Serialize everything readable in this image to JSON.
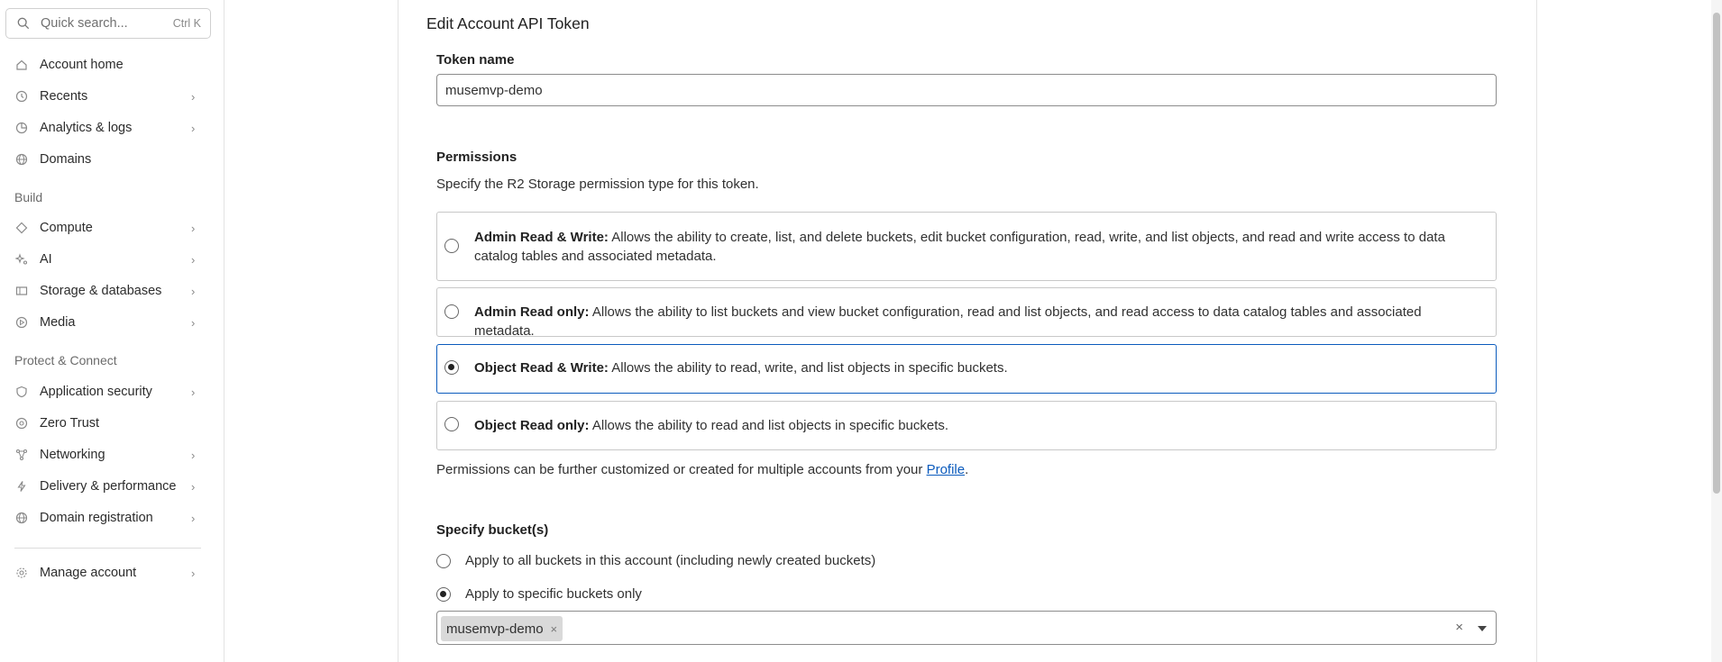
{
  "search": {
    "placeholder": "Quick search...",
    "shortcut": "Ctrl K"
  },
  "sidebar": {
    "top_items": [
      {
        "label": "Account home",
        "icon": "home-icon"
      },
      {
        "label": "Recents",
        "icon": "clock-icon"
      },
      {
        "label": "Analytics & logs",
        "icon": "chart-icon"
      },
      {
        "label": "Domains",
        "icon": "globe-icon"
      }
    ],
    "build_header": "Build",
    "build_items": [
      {
        "label": "Compute",
        "icon": "diamond-icon"
      },
      {
        "label": "AI",
        "icon": "sparkle-icon"
      },
      {
        "label": "Storage & databases",
        "icon": "storage-icon"
      },
      {
        "label": "Media",
        "icon": "media-icon"
      }
    ],
    "protect_header": "Protect & Connect",
    "protect_items": [
      {
        "label": "Application security",
        "icon": "shield-icon"
      },
      {
        "label": "Zero Trust",
        "icon": "zero-trust-icon"
      },
      {
        "label": "Networking",
        "icon": "network-icon"
      },
      {
        "label": "Delivery & performance",
        "icon": "bolt-icon"
      },
      {
        "label": "Domain registration",
        "icon": "globe-icon"
      }
    ],
    "manage_account": "Manage account"
  },
  "page": {
    "title": "Edit Account API Token",
    "token_name_label": "Token name",
    "token_name_value": "musemvp-demo",
    "permissions_label": "Permissions",
    "permissions_desc": "Specify the R2 Storage permission type for this token.",
    "permission_options": [
      {
        "title": "Admin Read & Write:",
        "desc": " Allows the ability to create, list, and delete buckets, edit bucket configuration, read, write, and list objects, and read and write access to data catalog tables and associated metadata.",
        "selected": false
      },
      {
        "title": "Admin Read only:",
        "desc": " Allows the ability to list buckets and view bucket configuration, read and list objects, and read access to data catalog tables and associated metadata.",
        "selected": false
      },
      {
        "title": "Object Read & Write:",
        "desc": " Allows the ability to read, write, and list objects in specific buckets.",
        "selected": true
      },
      {
        "title": "Object Read only:",
        "desc": " Allows the ability to read and list objects in specific buckets.",
        "selected": false
      }
    ],
    "permissions_note_pre": "Permissions can be further customized or created for multiple accounts from your ",
    "permissions_note_link": "Profile",
    "permissions_note_post": ".",
    "buckets_label": "Specify bucket(s)",
    "bucket_options": [
      {
        "label": "Apply to all buckets in this account (including newly created buckets)",
        "selected": false
      },
      {
        "label": "Apply to specific buckets only",
        "selected": true
      }
    ],
    "selected_buckets": [
      "musemvp-demo"
    ],
    "chip_remove": "×",
    "clear_all": "×"
  }
}
